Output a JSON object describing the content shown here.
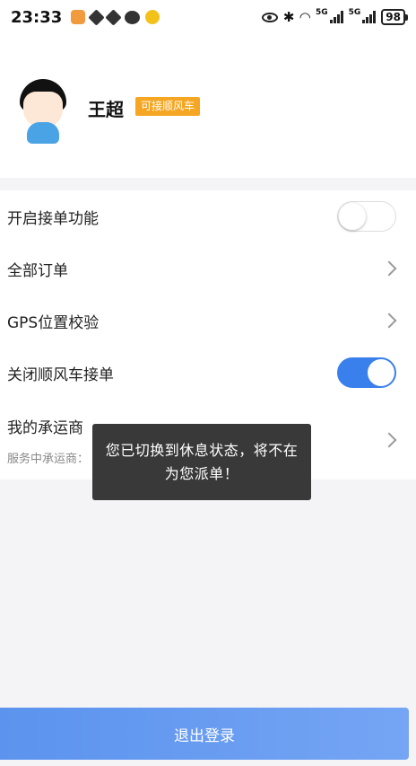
{
  "status_bar": {
    "time": "23:33",
    "network_1": "5G",
    "network_2": "5G",
    "battery": "98"
  },
  "profile": {
    "name": "王超",
    "badge": "可接顺风车"
  },
  "menu": {
    "items": [
      {
        "label": "开启接单功能",
        "control": "toggle",
        "toggle_on": false
      },
      {
        "label": "全部订单",
        "control": "chevron"
      },
      {
        "label": "GPS位置校验",
        "control": "chevron"
      },
      {
        "label": "关闭顺风车接单",
        "control": "toggle",
        "toggle_on": true
      },
      {
        "label": "我的承运商",
        "control": "chevron"
      }
    ],
    "carrier_prefix": "服务中承运商："
  },
  "toast": {
    "message": "您已切换到休息状态，将不在为您派单！"
  },
  "logout": {
    "label": "退出登录"
  },
  "colors": {
    "accent_blue": "#3a80ec",
    "badge_orange": "#f5a623"
  }
}
